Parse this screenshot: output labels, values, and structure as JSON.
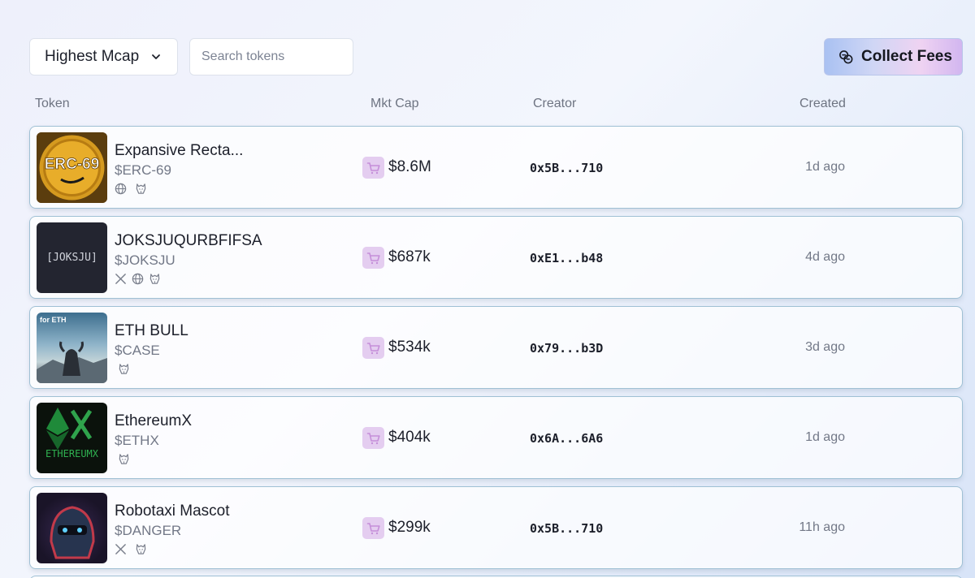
{
  "toolbar": {
    "sort_label": "Highest Mcap",
    "search_placeholder": "Search tokens",
    "collect_label": "Collect Fees"
  },
  "columns": {
    "token": "Token",
    "mkt_cap": "Mkt Cap",
    "creator": "Creator",
    "created": "Created"
  },
  "colors": {
    "row_border": "#9fc0d4",
    "cart_bg": "#e4cdf0",
    "cart_icon": "#c58fd9",
    "accent_gradient_start": "#a9c1f2",
    "accent_gradient_end": "#d2b6f0"
  },
  "tokens": [
    {
      "name": "Expansive Recta...",
      "ticker": "$ERC-69",
      "thumb_text": "ERC-69",
      "socials": [
        "globe-icon",
        "mask-icon"
      ],
      "mkt_cap": "$8.6M",
      "creator": "0x5B...710",
      "created": "1d ago"
    },
    {
      "name": "JOKSJUQURBFIFSA",
      "ticker": "$JOKSJU",
      "thumb_text": "[JOKSJU]",
      "socials": [
        "x-icon",
        "globe-icon",
        "mask-icon"
      ],
      "mkt_cap": "$687k",
      "creator": "0xE1...b48",
      "created": "4d ago"
    },
    {
      "name": "ETH BULL",
      "ticker": "$CASE",
      "thumb_text": "for ETH",
      "socials": [
        "mask-icon"
      ],
      "mkt_cap": "$534k",
      "creator": "0x79...b3D",
      "created": "3d ago"
    },
    {
      "name": "EthereumX",
      "ticker": "$ETHX",
      "thumb_text": "ETHEREUMX",
      "socials": [
        "mask-icon"
      ],
      "mkt_cap": "$404k",
      "creator": "0x6A...6A6",
      "created": "1d ago"
    },
    {
      "name": "Robotaxi Mascot",
      "ticker": "$DANGER",
      "thumb_text": "",
      "socials": [
        "x-icon",
        "mask-icon"
      ],
      "mkt_cap": "$299k",
      "creator": "0x5B...710",
      "created": "11h ago"
    }
  ]
}
